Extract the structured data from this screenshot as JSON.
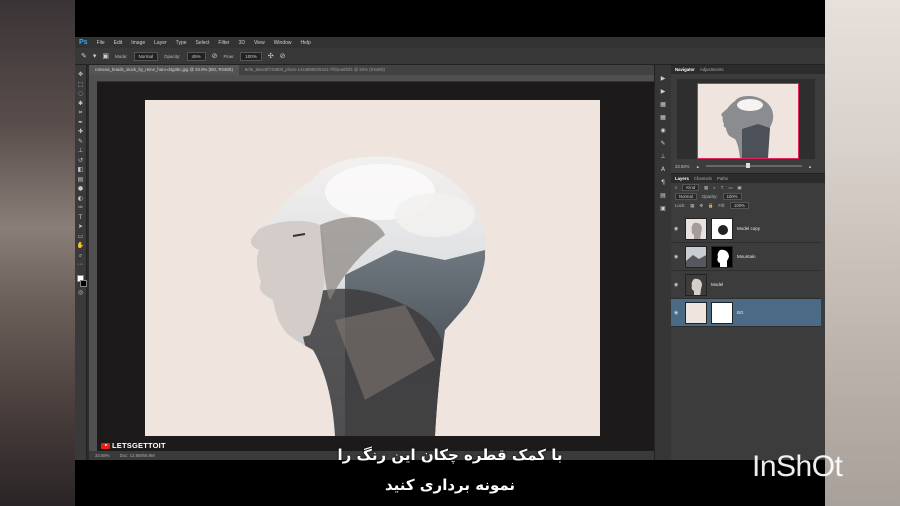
{
  "app": {
    "menu": [
      "File",
      "Edit",
      "Image",
      "Layer",
      "Type",
      "Select",
      "Filter",
      "3D",
      "View",
      "Window",
      "Help"
    ]
  },
  "options": {
    "mode_label": "Mode:",
    "mode_value": "Normal",
    "opacity_label": "Opacity:",
    "opacity_value": "45%",
    "flow_label": "Flow:",
    "flow_value": "100%"
  },
  "documents": {
    "tabs": [
      "romena_braids_stock_by_reine_haru-d4g35c.jpg @ 33.9% (BG, RGB/8)",
      "8efe_56ac8f748809_photo-1443889025422-7f03ea9f2f4 @ 50% (RGB/8)"
    ]
  },
  "status": {
    "zoom": "33.88%",
    "doc": "Doc: 13.8M/59.9M"
  },
  "watermark": {
    "text": "LETSGETTOIT"
  },
  "panels": {
    "navigator_tab": "Navigator",
    "adjustments_tab": "Adjustments",
    "nav_zoom": "33.88%",
    "layers_tab": "Layers",
    "channels_tab": "Channels",
    "paths_tab": "Paths",
    "kind_label": "Kind",
    "blend_mode": "Normal",
    "opacity_label": "Opacity:",
    "opacity_value": "100%",
    "lock_label": "Lock:",
    "fill_label": "Fill:",
    "fill_value": "100%",
    "layers": [
      {
        "name": "Model copy"
      },
      {
        "name": "Mountain"
      },
      {
        "name": "Model"
      },
      {
        "name": "BG"
      }
    ]
  },
  "subtitle": {
    "line1": "با کمک قطره چکان این رنگ را",
    "line2": "نمونه برداری کنید"
  },
  "inshot": {
    "text": "InShOt"
  },
  "colors": {
    "canvas_bg": "#efe5de",
    "selection": "#4a6a85",
    "ps_blue": "#31a8ff"
  }
}
